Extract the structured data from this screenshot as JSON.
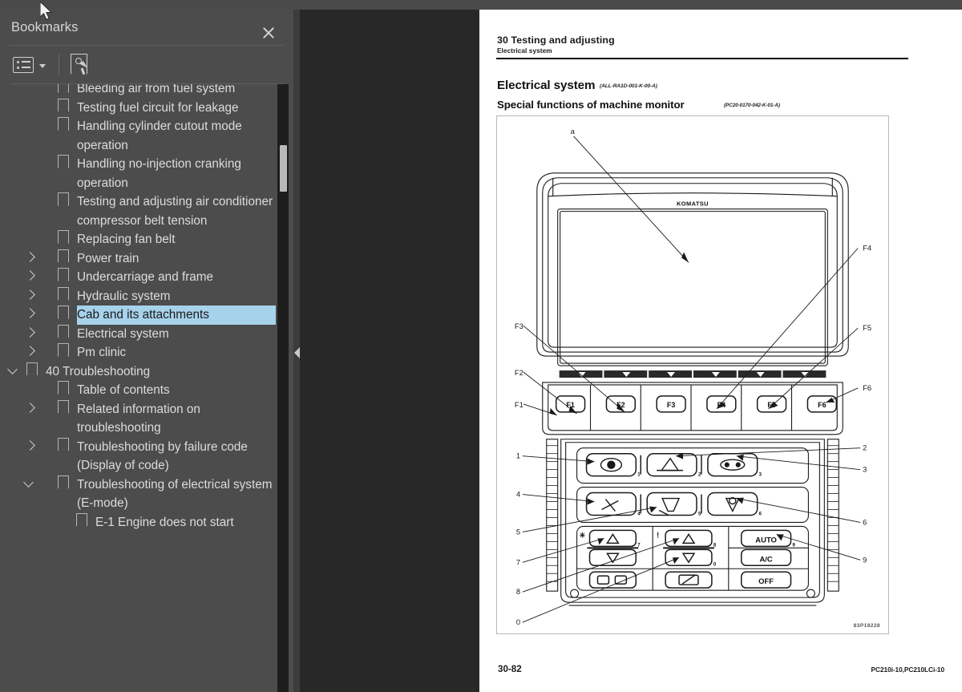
{
  "panel": {
    "title": "Bookmarks",
    "close_icon": "close-icon",
    "toolbar": {
      "options_icon": "list-options-icon",
      "dropdown_icon": "chevron-down-icon",
      "new_bookmark_icon": "new-bookmark-icon"
    }
  },
  "bookmarks": [
    {
      "label": "Bleeding air from fuel system",
      "depth": 2,
      "chevron": "none",
      "selected": false
    },
    {
      "label": "Testing fuel circuit for leakage",
      "depth": 2,
      "chevron": "none",
      "selected": false
    },
    {
      "label": "Handling cylinder cutout mode operation",
      "depth": 2,
      "chevron": "none",
      "selected": false
    },
    {
      "label": "Handling no-injection cranking operation",
      "depth": 2,
      "chevron": "none",
      "selected": false
    },
    {
      "label": "Testing and adjusting air conditioner compressor belt tension",
      "depth": 2,
      "chevron": "none",
      "selected": false
    },
    {
      "label": "Replacing fan belt",
      "depth": 2,
      "chevron": "none",
      "selected": false
    },
    {
      "label": "Power train",
      "depth": 2,
      "chevron": "right",
      "selected": false
    },
    {
      "label": "Undercarriage and frame",
      "depth": 2,
      "chevron": "right",
      "selected": false
    },
    {
      "label": "Hydraulic system",
      "depth": 2,
      "chevron": "right",
      "selected": false
    },
    {
      "label": "Cab and its attachments",
      "depth": 2,
      "chevron": "right",
      "selected": true
    },
    {
      "label": "Electrical system",
      "depth": 2,
      "chevron": "right",
      "selected": false
    },
    {
      "label": "Pm clinic",
      "depth": 2,
      "chevron": "right",
      "selected": false
    },
    {
      "label": "40 Troubleshooting",
      "depth": 1,
      "chevron": "down",
      "selected": false
    },
    {
      "label": "Table of contents",
      "depth": 2,
      "chevron": "none",
      "selected": false
    },
    {
      "label": "Related information on troubleshooting",
      "depth": 2,
      "chevron": "right",
      "selected": false
    },
    {
      "label": "Troubleshooting by failure code (Display of code)",
      "depth": 2,
      "chevron": "right",
      "selected": false
    },
    {
      "label": "Troubleshooting of electrical system (E-mode)",
      "depth": 2,
      "chevron": "down",
      "selected": false
    },
    {
      "label": "E-1 Engine does not start",
      "depth": 3,
      "chevron": "none",
      "selected": false
    }
  ],
  "document": {
    "header_title": "30 Testing and adjusting",
    "header_subtitle": "Electrical system",
    "section_title": "Electrical system",
    "section_code": "(ALL-RA1D-001-K-00-A)",
    "subsection_title": "Special functions of machine monitor",
    "subsection_code": "(PC20-0170-042-K-01-A)",
    "figure": {
      "id_code": "83P18228",
      "brand": "KOMATSU",
      "callouts_letters": [
        "a"
      ],
      "function_keys": [
        "F1",
        "F2",
        "F3",
        "F4",
        "F5",
        "F6"
      ],
      "key_caps": [
        "F1",
        "F2",
        "F3",
        "F4",
        "F5",
        "F6"
      ],
      "callouts_numbers": [
        "1",
        "2",
        "3",
        "4",
        "5",
        "6",
        "7",
        "8",
        "9",
        "0"
      ],
      "keypad_labels": [
        "AUTO",
        "A/C",
        "OFF"
      ],
      "keypad_digits": [
        "1",
        "2",
        "3",
        "4",
        "5",
        "6",
        "7",
        "8",
        "9",
        "0"
      ]
    },
    "footer_left": "30-82",
    "footer_right": "PC210i-10,PC210LCi-10"
  },
  "colors": {
    "panel_bg": "#4c4c4c",
    "viewer_bg": "#282828",
    "selection": "#a7d2eb",
    "page_bg": "#ffffff",
    "text": "#dcdcdc"
  }
}
